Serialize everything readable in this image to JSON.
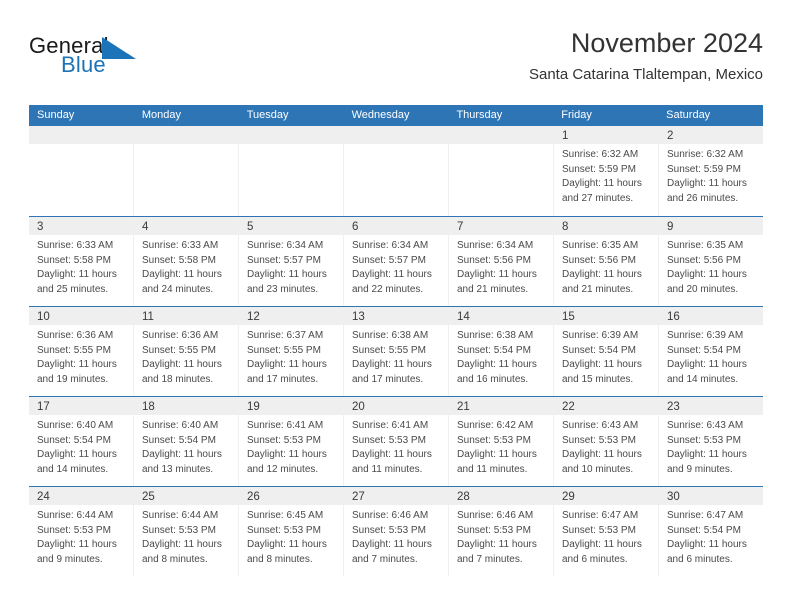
{
  "brand": {
    "name_part1": "General",
    "name_part2": "Blue",
    "accent_color": "#1d73b8",
    "flag_icon": "triangle-flag-icon"
  },
  "header": {
    "month_title": "November 2024",
    "location": "Santa Catarina Tlaltempan, Mexico"
  },
  "calendar": {
    "header_color": "#2e75b6",
    "daynum_band_color": "#efefef",
    "weekday_headers": [
      "Sunday",
      "Monday",
      "Tuesday",
      "Wednesday",
      "Thursday",
      "Friday",
      "Saturday"
    ],
    "weeks": [
      [
        {
          "day": "",
          "lines": []
        },
        {
          "day": "",
          "lines": []
        },
        {
          "day": "",
          "lines": []
        },
        {
          "day": "",
          "lines": []
        },
        {
          "day": "",
          "lines": []
        },
        {
          "day": "1",
          "lines": [
            "Sunrise: 6:32 AM",
            "Sunset: 5:59 PM",
            "Daylight: 11 hours",
            "and 27 minutes."
          ]
        },
        {
          "day": "2",
          "lines": [
            "Sunrise: 6:32 AM",
            "Sunset: 5:59 PM",
            "Daylight: 11 hours",
            "and 26 minutes."
          ]
        }
      ],
      [
        {
          "day": "3",
          "lines": [
            "Sunrise: 6:33 AM",
            "Sunset: 5:58 PM",
            "Daylight: 11 hours",
            "and 25 minutes."
          ]
        },
        {
          "day": "4",
          "lines": [
            "Sunrise: 6:33 AM",
            "Sunset: 5:58 PM",
            "Daylight: 11 hours",
            "and 24 minutes."
          ]
        },
        {
          "day": "5",
          "lines": [
            "Sunrise: 6:34 AM",
            "Sunset: 5:57 PM",
            "Daylight: 11 hours",
            "and 23 minutes."
          ]
        },
        {
          "day": "6",
          "lines": [
            "Sunrise: 6:34 AM",
            "Sunset: 5:57 PM",
            "Daylight: 11 hours",
            "and 22 minutes."
          ]
        },
        {
          "day": "7",
          "lines": [
            "Sunrise: 6:34 AM",
            "Sunset: 5:56 PM",
            "Daylight: 11 hours",
            "and 21 minutes."
          ]
        },
        {
          "day": "8",
          "lines": [
            "Sunrise: 6:35 AM",
            "Sunset: 5:56 PM",
            "Daylight: 11 hours",
            "and 21 minutes."
          ]
        },
        {
          "day": "9",
          "lines": [
            "Sunrise: 6:35 AM",
            "Sunset: 5:56 PM",
            "Daylight: 11 hours",
            "and 20 minutes."
          ]
        }
      ],
      [
        {
          "day": "10",
          "lines": [
            "Sunrise: 6:36 AM",
            "Sunset: 5:55 PM",
            "Daylight: 11 hours",
            "and 19 minutes."
          ]
        },
        {
          "day": "11",
          "lines": [
            "Sunrise: 6:36 AM",
            "Sunset: 5:55 PM",
            "Daylight: 11 hours",
            "and 18 minutes."
          ]
        },
        {
          "day": "12",
          "lines": [
            "Sunrise: 6:37 AM",
            "Sunset: 5:55 PM",
            "Daylight: 11 hours",
            "and 17 minutes."
          ]
        },
        {
          "day": "13",
          "lines": [
            "Sunrise: 6:38 AM",
            "Sunset: 5:55 PM",
            "Daylight: 11 hours",
            "and 17 minutes."
          ]
        },
        {
          "day": "14",
          "lines": [
            "Sunrise: 6:38 AM",
            "Sunset: 5:54 PM",
            "Daylight: 11 hours",
            "and 16 minutes."
          ]
        },
        {
          "day": "15",
          "lines": [
            "Sunrise: 6:39 AM",
            "Sunset: 5:54 PM",
            "Daylight: 11 hours",
            "and 15 minutes."
          ]
        },
        {
          "day": "16",
          "lines": [
            "Sunrise: 6:39 AM",
            "Sunset: 5:54 PM",
            "Daylight: 11 hours",
            "and 14 minutes."
          ]
        }
      ],
      [
        {
          "day": "17",
          "lines": [
            "Sunrise: 6:40 AM",
            "Sunset: 5:54 PM",
            "Daylight: 11 hours",
            "and 14 minutes."
          ]
        },
        {
          "day": "18",
          "lines": [
            "Sunrise: 6:40 AM",
            "Sunset: 5:54 PM",
            "Daylight: 11 hours",
            "and 13 minutes."
          ]
        },
        {
          "day": "19",
          "lines": [
            "Sunrise: 6:41 AM",
            "Sunset: 5:53 PM",
            "Daylight: 11 hours",
            "and 12 minutes."
          ]
        },
        {
          "day": "20",
          "lines": [
            "Sunrise: 6:41 AM",
            "Sunset: 5:53 PM",
            "Daylight: 11 hours",
            "and 11 minutes."
          ]
        },
        {
          "day": "21",
          "lines": [
            "Sunrise: 6:42 AM",
            "Sunset: 5:53 PM",
            "Daylight: 11 hours",
            "and 11 minutes."
          ]
        },
        {
          "day": "22",
          "lines": [
            "Sunrise: 6:43 AM",
            "Sunset: 5:53 PM",
            "Daylight: 11 hours",
            "and 10 minutes."
          ]
        },
        {
          "day": "23",
          "lines": [
            "Sunrise: 6:43 AM",
            "Sunset: 5:53 PM",
            "Daylight: 11 hours",
            "and 9 minutes."
          ]
        }
      ],
      [
        {
          "day": "24",
          "lines": [
            "Sunrise: 6:44 AM",
            "Sunset: 5:53 PM",
            "Daylight: 11 hours",
            "and 9 minutes."
          ]
        },
        {
          "day": "25",
          "lines": [
            "Sunrise: 6:44 AM",
            "Sunset: 5:53 PM",
            "Daylight: 11 hours",
            "and 8 minutes."
          ]
        },
        {
          "day": "26",
          "lines": [
            "Sunrise: 6:45 AM",
            "Sunset: 5:53 PM",
            "Daylight: 11 hours",
            "and 8 minutes."
          ]
        },
        {
          "day": "27",
          "lines": [
            "Sunrise: 6:46 AM",
            "Sunset: 5:53 PM",
            "Daylight: 11 hours",
            "and 7 minutes."
          ]
        },
        {
          "day": "28",
          "lines": [
            "Sunrise: 6:46 AM",
            "Sunset: 5:53 PM",
            "Daylight: 11 hours",
            "and 7 minutes."
          ]
        },
        {
          "day": "29",
          "lines": [
            "Sunrise: 6:47 AM",
            "Sunset: 5:53 PM",
            "Daylight: 11 hours",
            "and 6 minutes."
          ]
        },
        {
          "day": "30",
          "lines": [
            "Sunrise: 6:47 AM",
            "Sunset: 5:54 PM",
            "Daylight: 11 hours",
            "and 6 minutes."
          ]
        }
      ]
    ]
  }
}
